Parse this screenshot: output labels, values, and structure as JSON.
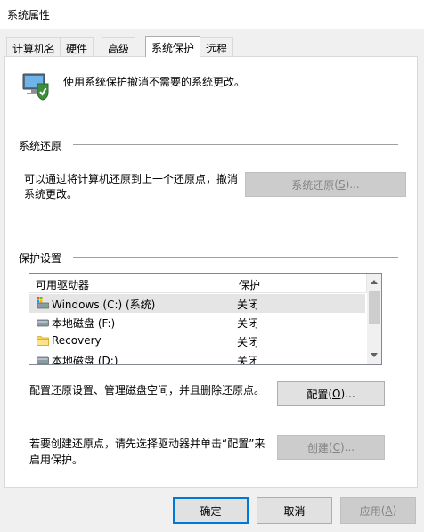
{
  "window": {
    "title": "系统属性"
  },
  "tabs": [
    {
      "label": "计算机名",
      "active": false
    },
    {
      "label": "硬件",
      "active": false
    },
    {
      "label": "高级",
      "active": false
    },
    {
      "label": "系统保护",
      "active": true
    },
    {
      "label": "远程",
      "active": false
    }
  ],
  "intro": {
    "text": "使用系统保护撤消不需要的系统更改。",
    "icon": "system-protection-icon"
  },
  "restore": {
    "section_title": "系统还原",
    "description_line1": "可以通过将计算机还原到上一个还原点，撤消",
    "description_line2": "系统更改。",
    "button_label": "系统还原",
    "button_mnemonic": "S",
    "button_suffix": "...",
    "button_enabled": false
  },
  "protection": {
    "section_title": "保护设置",
    "columns": [
      "可用驱动器",
      "保护"
    ],
    "drives": [
      {
        "name": "Windows (C:) (系统)",
        "protection": "关闭",
        "icon": "system-drive-icon",
        "selected": true
      },
      {
        "name": "本地磁盘 (F:)",
        "protection": "关闭",
        "icon": "local-disk-icon",
        "selected": false
      },
      {
        "name": "Recovery",
        "protection": "关闭",
        "icon": "folder-icon",
        "selected": false
      },
      {
        "name": "本地磁盘 (D:)",
        "protection": "关闭",
        "icon": "local-disk-icon",
        "selected": false
      }
    ],
    "configure_text": "配置还原设置、管理磁盘空间，并且删除还原点。",
    "configure_label": "配置",
    "configure_mnemonic": "O",
    "configure_suffix": "...",
    "create_text_line1": "若要创建还原点，请先选择驱动器并单击“配置”来",
    "create_text_line2": "启用保护。",
    "create_label": "创建",
    "create_mnemonic": "C",
    "create_suffix": "...",
    "create_enabled": false
  },
  "footer": {
    "ok_label": "确定",
    "cancel_label": "取消",
    "apply_label": "应用",
    "apply_mnemonic": "A",
    "apply_enabled": false
  },
  "colors": {
    "accent": "#0078d7",
    "disabled_text": "#838383",
    "selection": "#e5e5e5"
  }
}
